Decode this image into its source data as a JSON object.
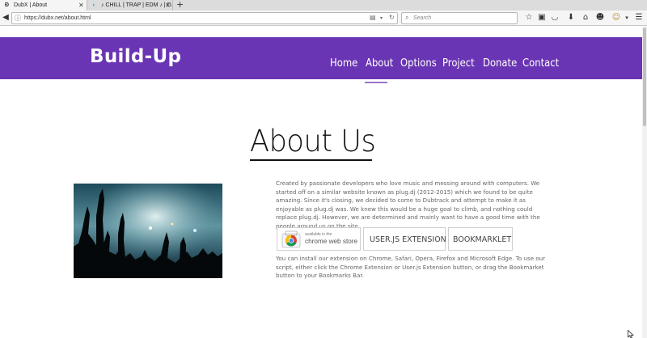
{
  "browser": {
    "tabs": [
      {
        "title": "DubX | About",
        "favicon": "dubx-favicon-icon"
      },
      {
        "title": "♪ CHILL | TRAP | EDM ♪ | D...",
        "favicon": "dubtrack-favicon-icon"
      }
    ],
    "url": "https://dubx.net/about.html",
    "search_placeholder": "Search"
  },
  "site": {
    "brand": "Build-Up",
    "nav": [
      {
        "label": "Home"
      },
      {
        "label": "About",
        "active": true
      },
      {
        "label": "Options"
      },
      {
        "label": "Project"
      },
      {
        "label": "Donate"
      },
      {
        "label": "Contact"
      }
    ],
    "header_color": "#6a35b4"
  },
  "main": {
    "title": "About Us",
    "paragraph1": "Created by passionate developers who love music and messing around with computers. We started off on a similar website known as plug.dj (2012-2015) which we found to be quite amazing. Since it's closing, we decided to come to Dubtrack and attempt to make it as enjoyable as plug.dj was. We knew this would be a huge goal to climb, and nothing could replace plug.dj. However, we are determined and mainly want to have a good time with the people around us on the site.",
    "buttons": {
      "chrome_small": "available in the",
      "chrome_big": "chrome web store",
      "userjs": "USER.JS EXTENSION",
      "bookmarklet": "BOOKMARKLET"
    },
    "paragraph2": "You can install our extension on Chrome, Safari, Opera, Firefox and Microsoft Edge. To use our script, either click the Chrome Extension or User.js Extension button, or drag the Bookmarket button to your Bookmarks Bar."
  }
}
